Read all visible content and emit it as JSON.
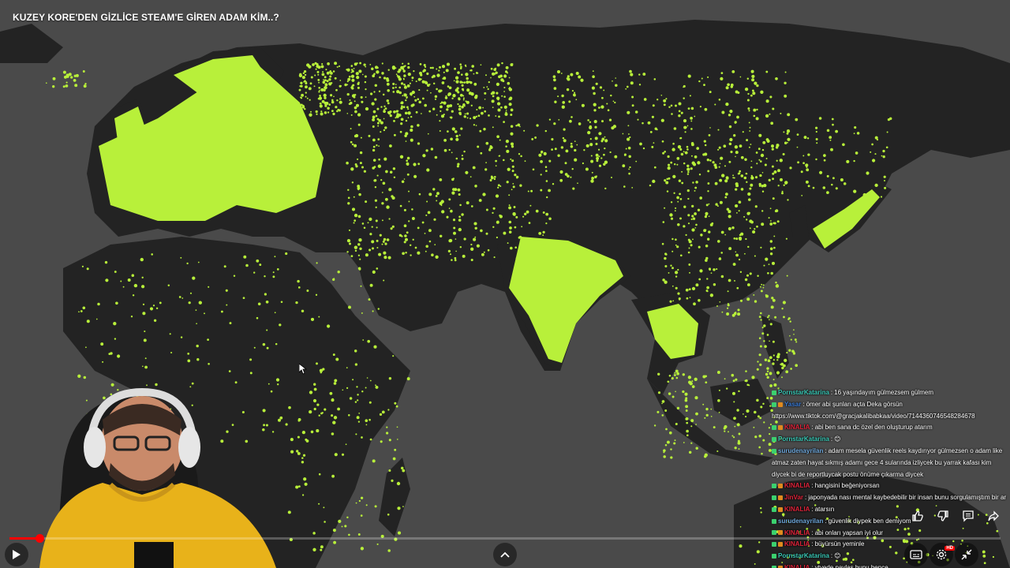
{
  "video": {
    "title": "KUZEY KORE'DEN GİZLİCE STEAM'E GİREN ADAM KİM..?",
    "progress_fraction": 0.03
  },
  "map": {
    "ocean_color": "#4a4a4a",
    "land_color": "#232323",
    "highlight_color": "#b8f03a"
  },
  "chat": {
    "lines": [
      {
        "user": "PornstarKatarina",
        "user_color": "#39c8b6",
        "text": "16 yaşındayım gülmezsem gülmem"
      },
      {
        "user": "Yasar",
        "user_color": "#3a7bd5",
        "text": "ömer abi şunları açta Deka görsün https://www.tiktok.com/@gracjakalibabkaa/video/7144360746548284678"
      },
      {
        "user": "KINALIA",
        "user_color": "#e0233a",
        "text": "abi ben sana dc özel den oluşturup atarım"
      },
      {
        "user": "PornstarKatarina",
        "user_color": "#39c8b6",
        "text": "😊"
      },
      {
        "user": "surudenayrilan",
        "user_color": "#6fa8dc",
        "text": "adam mesela güvenlik reels kaydırıyor gülmezsen o adam like atmaz zaten hayat sıkmış adamı gece 4 sularında izliycek bu yarrak kafası kim diycek bi de reportluycak postu önüme çıkarma diycek"
      },
      {
        "user": "KINALIA",
        "user_color": "#e0233a",
        "text": "hangisini beğeniyorsan"
      },
      {
        "user": "JinVar",
        "user_color": "#e0233a",
        "text": "japonyada nası mental kaybedebilir bir insan bunu sorgulamıştım bir ar"
      },
      {
        "user": "KINALIA",
        "user_color": "#e0233a",
        "text": "atarsın"
      },
      {
        "user": "surudenayrilan",
        "user_color": "#6fa8dc",
        "text": "güvenlik diypek ben demiyom"
      },
      {
        "user": "KINALIA",
        "user_color": "#e0233a",
        "text": "abi onları yapsan iyi olur"
      },
      {
        "user": "KINALIA",
        "user_color": "#e0233a",
        "text": "büyürsün yeminle"
      },
      {
        "user": "PornstarKatarina",
        "user_color": "#39c8b6",
        "text": "😊"
      },
      {
        "user": "KINALIA",
        "user_color": "#e0233a",
        "text": "ytyede paylaş bunu bence"
      }
    ]
  },
  "controls": {
    "play_icon": "play-icon",
    "expand_icon": "chevron-up-icon",
    "like_icon": "thumbs-up-icon",
    "dislike_icon": "thumbs-down-icon",
    "comment_icon": "comment-icon",
    "share_icon": "share-icon",
    "subtitles_icon": "subtitles-icon",
    "settings_icon": "settings-gear-icon",
    "settings_badge": "HD",
    "collapse_icon": "collapse-arrows-icon"
  }
}
